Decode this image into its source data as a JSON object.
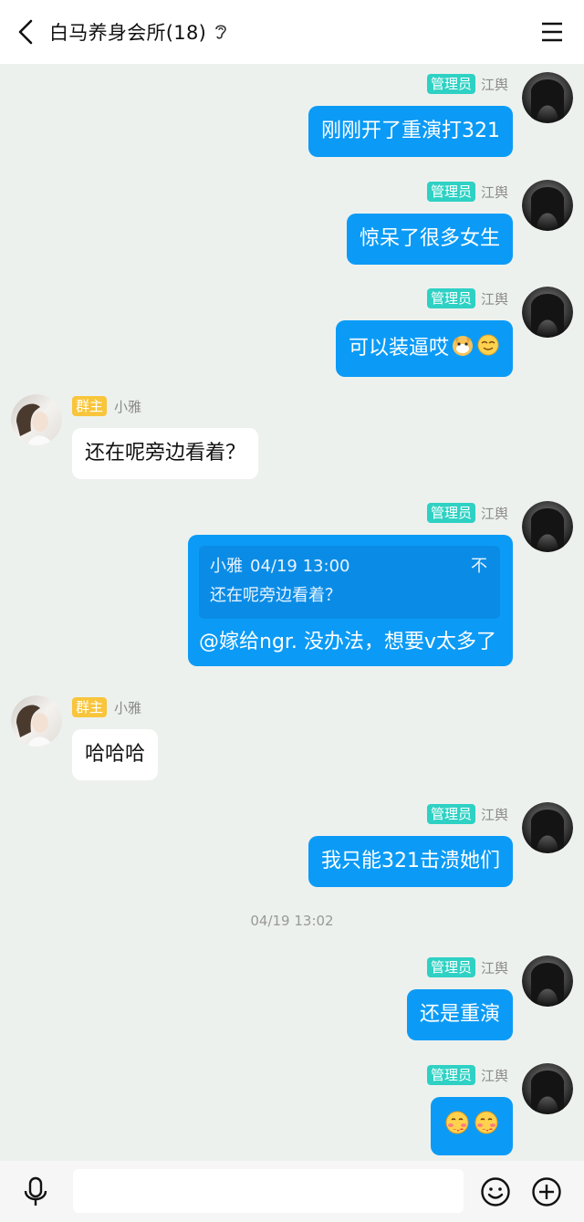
{
  "header": {
    "title": "白马养身会所(18)"
  },
  "roles": {
    "admin": "管理员",
    "owner": "群主"
  },
  "users": {
    "jiangyu": "江舆",
    "xiaoya": "小雅"
  },
  "messages": [
    {
      "text": "刚刚开了重演打321"
    },
    {
      "text": "惊呆了很多女生"
    },
    {
      "text": "可以装逼哎"
    },
    {
      "text": "还在呢旁边看着？"
    },
    {
      "text": ""
    },
    {
      "text": "哈哈哈"
    },
    {
      "text": "我只能321击溃她们"
    },
    {
      "text": "还是重演"
    },
    {
      "text": ""
    }
  ],
  "reply": {
    "quote_author": "小雅",
    "quote_time": "04/19 13:00",
    "quote_text": "还在呢旁边看着？",
    "quote_close": "不",
    "text": "@嫁给ngr. 没办法，想要v太多了"
  },
  "timestamp": "04/19 13:02",
  "input": {
    "placeholder": ""
  },
  "colors": {
    "bubble_out": "#0b9bf6",
    "bubble_in": "#ffffff",
    "background": "#edf1ee",
    "admin_badge": "#2ed1c3",
    "owner_badge": "#f8c53b"
  },
  "icons": [
    "back-icon",
    "ear-icon",
    "menu-icon",
    "mic-icon",
    "emoji-icon",
    "plus-icon"
  ]
}
